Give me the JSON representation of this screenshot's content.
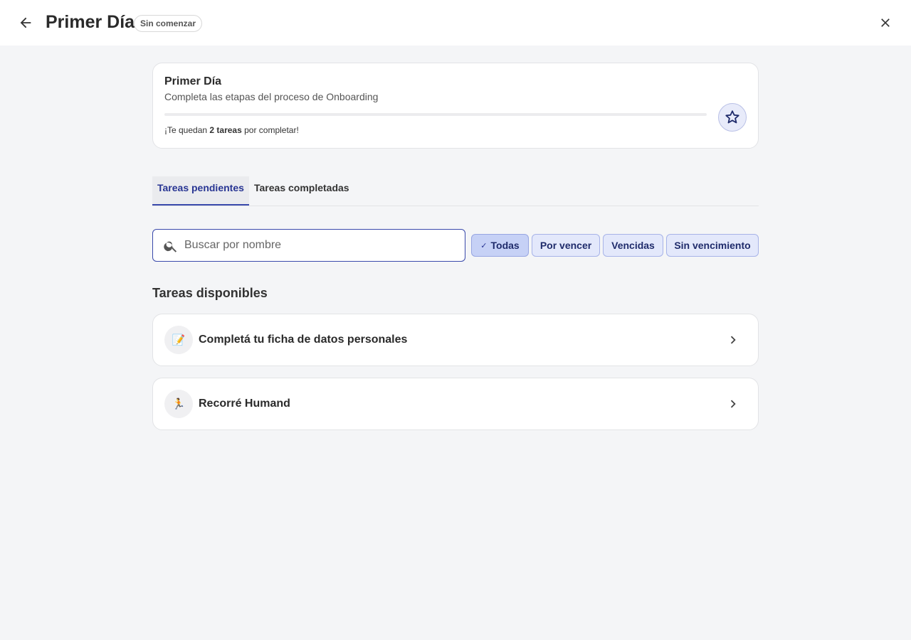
{
  "header": {
    "title": "Primer Día",
    "status_badge": "Sin comenzar"
  },
  "progress_card": {
    "title": "Primer Día",
    "subtitle": "Completa las etapas del proceso de Onboarding",
    "progress_fraction": 0,
    "remaining_prefix": "¡Te quedan ",
    "remaining_count": "2 tareas",
    "remaining_suffix": " por completar!"
  },
  "tabs": [
    {
      "label": "Tareas pendientes",
      "active": true
    },
    {
      "label": "Tareas completadas",
      "active": false
    }
  ],
  "search": {
    "placeholder": "Buscar por nombre",
    "value": ""
  },
  "filters": [
    {
      "label": "Todas",
      "selected": true
    },
    {
      "label": "Por vencer",
      "selected": false
    },
    {
      "label": "Vencidas",
      "selected": false
    },
    {
      "label": "Sin vencimiento",
      "selected": false
    }
  ],
  "section_title": "Tareas disponibles",
  "tasks": [
    {
      "emoji": "📝",
      "title": "Completá tu ficha de datos personales",
      "icon": "memo-icon"
    },
    {
      "emoji": "🏃",
      "title": "Recorré Humand",
      "icon": "runner-icon"
    }
  ],
  "colors": {
    "accent": "#3949ab",
    "chip_bg": "#e3e8fb",
    "background": "#f4f5f7"
  }
}
